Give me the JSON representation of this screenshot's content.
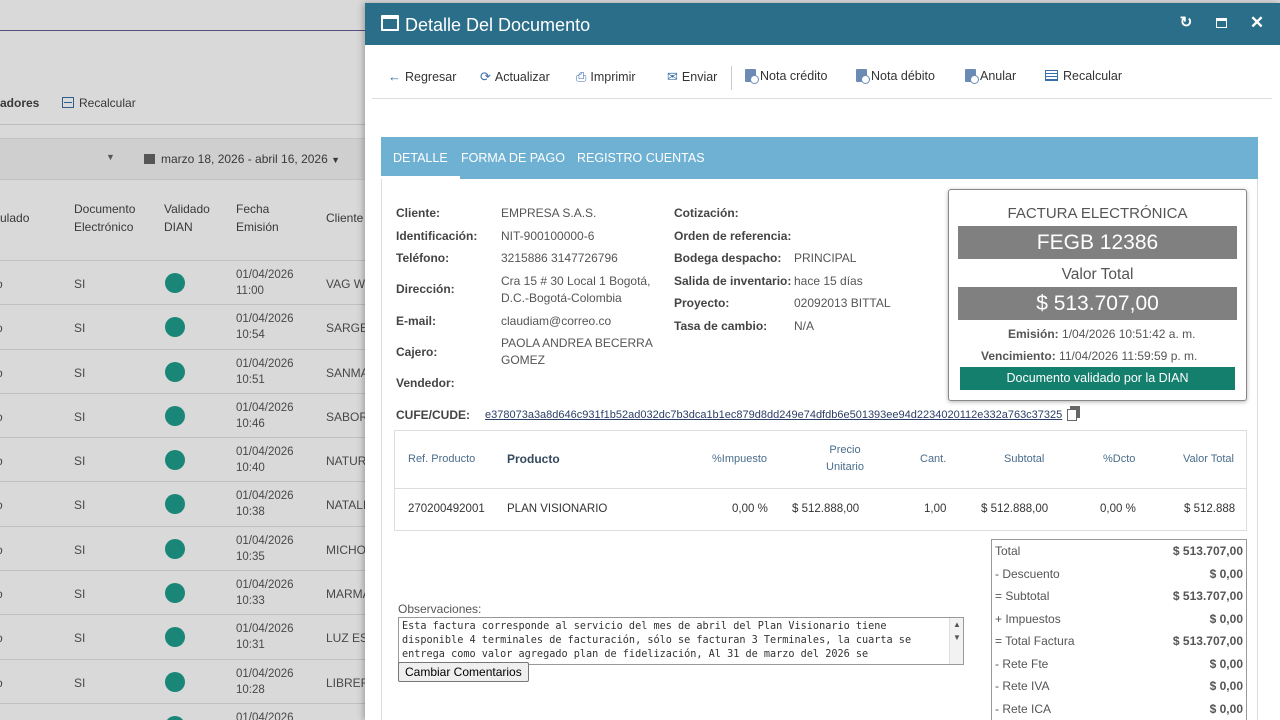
{
  "background": {
    "toolbar": {
      "validadores": "adores",
      "recalcular": "Recalcular"
    },
    "filter": {
      "date_range": "marzo 18, 2026 - abril 16, 2026"
    },
    "columns": {
      "anulado": "ulado",
      "documento": "Documento",
      "electronico": "Electrónico",
      "validado": "Validado",
      "dian": "DIAN",
      "fecha": "Fecha",
      "emision": "Emisión",
      "cliente": "Cliente"
    },
    "rows": [
      {
        "a": "o",
        "doc": "SI",
        "date": "01/04/2026",
        "time": "11:00",
        "cliente": "VAG WE"
      },
      {
        "a": "o",
        "doc": "SI",
        "date": "01/04/2026",
        "time": "10:54",
        "cliente": "SARGEN"
      },
      {
        "a": "o",
        "doc": "SI",
        "date": "01/04/2026",
        "time": "10:51",
        "cliente": "SANMA"
      },
      {
        "a": "o",
        "doc": "SI",
        "date": "01/04/2026",
        "time": "10:46",
        "cliente": "SABORE"
      },
      {
        "a": "o",
        "doc": "SI",
        "date": "01/04/2026",
        "time": "10:40",
        "cliente": "NATUR"
      },
      {
        "a": "o",
        "doc": "SI",
        "date": "01/04/2026",
        "time": "10:38",
        "cliente": "NATALI"
      },
      {
        "a": "o",
        "doc": "SI",
        "date": "01/04/2026",
        "time": "10:35",
        "cliente": "MICHO"
      },
      {
        "a": "o",
        "doc": "SI",
        "date": "01/04/2026",
        "time": "10:33",
        "cliente": "MARMA"
      },
      {
        "a": "o",
        "doc": "SI",
        "date": "01/04/2026",
        "time": "10:31",
        "cliente": "LUZ EST"
      },
      {
        "a": "o",
        "doc": "SI",
        "date": "01/04/2026",
        "time": "10:28",
        "cliente": "LIBRERI"
      },
      {
        "a": "o",
        "doc": "SI",
        "date": "01/04/2026",
        "time": "",
        "cliente": ""
      }
    ]
  },
  "modal": {
    "title": "Detalle Del Documento",
    "toolbar": {
      "regresar": "Regresar",
      "actualizar": "Actualizar",
      "imprimir": "Imprimir",
      "enviar": "Enviar",
      "nota_credito": "Nota crédito",
      "nota_debito": "Nota débito",
      "anular": "Anular",
      "recalcular": "Recalcular"
    },
    "tabs": {
      "detalle": "DETALLE",
      "forma_pago": "FORMA DE PAGO",
      "registro_cuentas": "REGISTRO CUENTAS"
    },
    "cliente": {
      "cliente_label": "Cliente:",
      "cliente": "EMPRESA S.A.S.",
      "identificacion_label": "Identificación:",
      "identificacion": "NIT-900100000-6",
      "telefono_label": "Teléfono:",
      "telefono": "3215886 3147726796",
      "direccion_label": "Dirección:",
      "direccion_1": "Cra 15 # 30 Local 1 Bogotá,",
      "direccion_2": "D.C.-Bogotá-Colombia",
      "email_label": "E-mail:",
      "email": "claudiam@correo.co",
      "cajero_label": "Cajero:",
      "cajero_1": "PAOLA ANDREA BECERRA",
      "cajero_2": "GOMEZ",
      "vendedor_label": "Vendedor:"
    },
    "extra": {
      "cotizacion_label": "Cotización:",
      "orden_label": "Orden de referencia:",
      "bodega_label": "Bodega despacho:",
      "bodega": "PRINCIPAL",
      "salida_label": "Salida de inventario:",
      "salida": "hace 15 días",
      "proyecto_label": "Proyecto:",
      "proyecto": "02092013 BITTAL",
      "tasa_label": "Tasa de cambio:",
      "tasa": "N/A"
    },
    "card": {
      "type": "FACTURA ELECTRÓNICA",
      "number": "FEGB 12386",
      "valor_total_label": "Valor Total",
      "valor_total": "$ 513.707,00",
      "emision_label": "Emisión:",
      "emision": "1/04/2026 10:51:42 a. m.",
      "vencimiento_label": "Vencimiento:",
      "vencimiento": "11/04/2026 11:59:59 p. m.",
      "badge": "Documento validado por la DIAN"
    },
    "cufe": {
      "label": "CUFE/CUDE:",
      "value": "e378073a3a8d646c931f1b52ad032dc7b3dca1b1ec879d8dd249e74dfdb6e501393ee94d2234020112e332a763c37325"
    },
    "products": {
      "headers": {
        "ref": "Ref. Producto",
        "producto": "Producto",
        "impuesto": "%Impuesto",
        "precio_1": "Precio",
        "precio_2": "Unitario",
        "cant": "Cant.",
        "subtotal": "Subtotal",
        "dcto": "%Dcto",
        "valor_total": "Valor Total"
      },
      "rows": [
        {
          "ref": "270200492001",
          "producto": "PLAN VISIONARIO",
          "impuesto": "0,00 %",
          "precio": "$ 512.888,00",
          "cant": "1,00",
          "subtotal": "$ 512.888,00",
          "dcto": "0,00 %",
          "valor_total": "$ 512.888"
        }
      ]
    },
    "totals": [
      {
        "label": "Total",
        "value": "$ 513.707,00"
      },
      {
        "label": "- Descuento",
        "value": "$ 0,00"
      },
      {
        "label": "= Subtotal",
        "value": "$ 513.707,00"
      },
      {
        "label": "+ Impuestos",
        "value": "$ 0,00"
      },
      {
        "label": "= Total Factura",
        "value": "$ 513.707,00"
      },
      {
        "label": "- Rete Fte",
        "value": "$ 0,00"
      },
      {
        "label": "- Rete IVA",
        "value": "$ 0,00"
      },
      {
        "label": "- Rete ICA",
        "value": "$ 0,00"
      }
    ],
    "observaciones": {
      "label": "Observaciones:",
      "text": "Esta factura corresponde al servicio del mes de abril del Plan Visionario tiene disponible 4 terminales de facturación, sólo se facturan 3 Terminales, la cuarta se entrega como valor agregado plan de fidelización, Al 31 de marzo del 2026 se",
      "button": "Cambiar Comentarios"
    }
  }
}
